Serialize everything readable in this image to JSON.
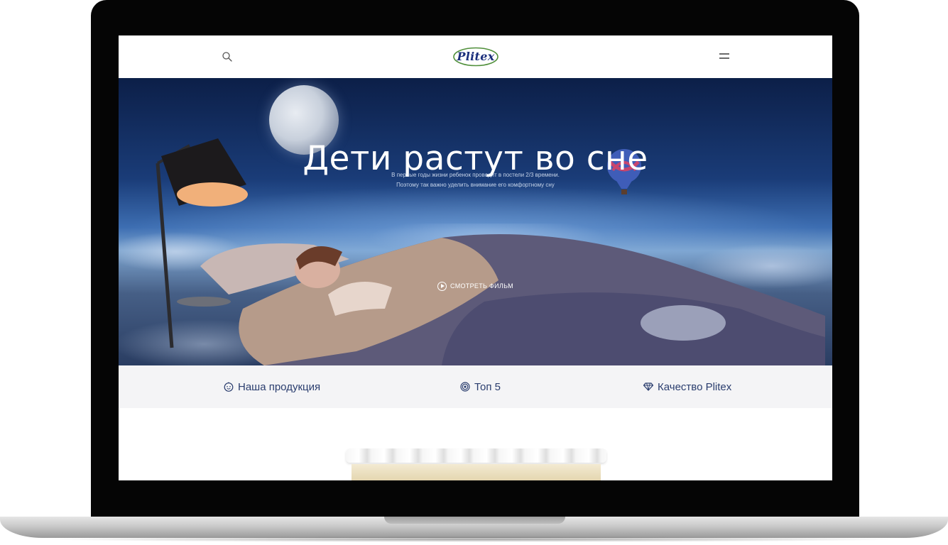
{
  "header": {
    "logo_text": "Plitex",
    "search_icon": "search-icon",
    "menu_icon": "menu-icon"
  },
  "hero": {
    "title": "Дети растут во сне",
    "subtitle_line1": "В первые годы жизни ребенок проводит в постели 2/3 времени.",
    "subtitle_line2": "Поэтому так важно уделить внимание его комфортному сну",
    "watch_label": "СМОТРЕТЬ ФИЛЬМ"
  },
  "nav": {
    "items": [
      {
        "label": "Наша продукция",
        "icon": "baby-face-icon"
      },
      {
        "label": "Топ 5",
        "icon": "target-icon"
      },
      {
        "label": "Качество Plitex",
        "icon": "diamond-icon"
      }
    ]
  },
  "colors": {
    "brand": "#1b2f7c",
    "nav_text": "#2a3d6e",
    "nav_bg": "#f4f4f6",
    "sky_top": "#0c1f48"
  }
}
